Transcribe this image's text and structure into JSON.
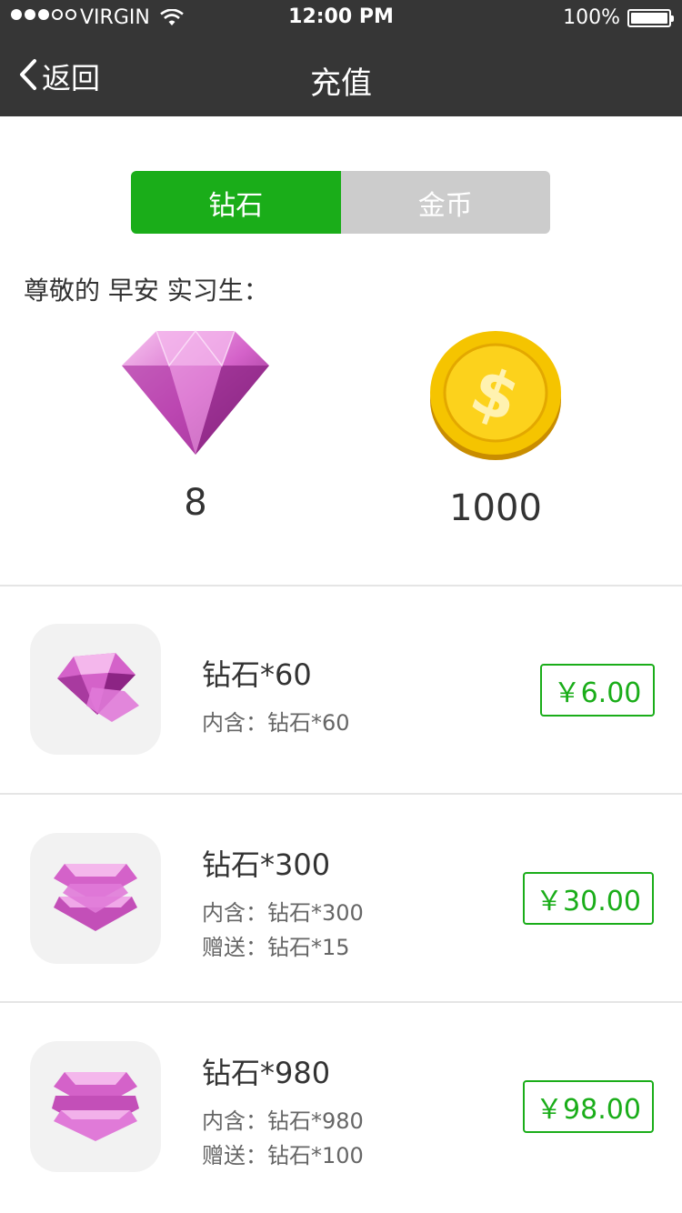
{
  "status_bar": {
    "carrier": "VIRGIN",
    "time": "12:00 PM",
    "battery": "100%",
    "battery_level": 1.0
  },
  "nav": {
    "back_label": "返回",
    "title": "充值"
  },
  "tabs": [
    {
      "label": "钻石",
      "active": true
    },
    {
      "label": "金币",
      "active": false
    }
  ],
  "greeting": "尊敬的 早安 实习生：",
  "balances": {
    "diamond": "8",
    "gold": "1000"
  },
  "colors": {
    "accent": "#1aad19",
    "navbar": "#363636",
    "diamond": "#e07ad8",
    "coin": "#f5c400"
  },
  "packages": [
    {
      "title": "钻石*60",
      "contains": "内含：钻石*60",
      "bonus": "",
      "price": "￥6.00"
    },
    {
      "title": "钻石*300",
      "contains": "内含：钻石*300",
      "bonus": "赠送：钻石*15",
      "price": "￥30.00"
    },
    {
      "title": "钻石*980",
      "contains": "内含：钻石*980",
      "bonus": "赠送：钻石*100",
      "price": "￥98.00"
    }
  ]
}
